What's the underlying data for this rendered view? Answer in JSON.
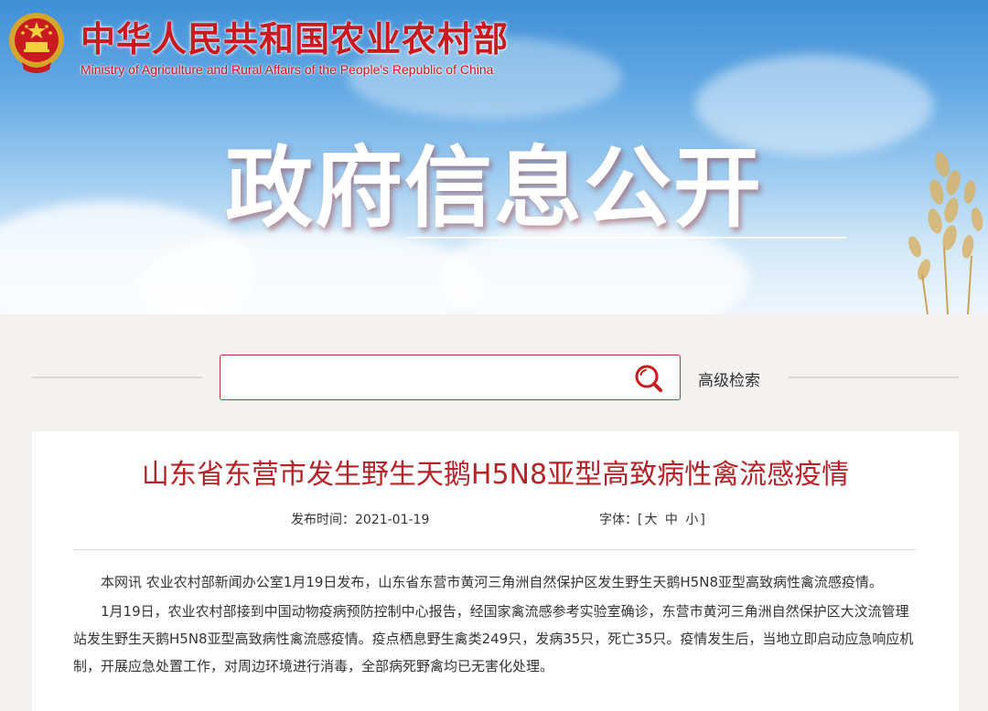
{
  "header": {
    "ministry_cn": "中华人民共和国农业农村部",
    "ministry_en": "Ministry of Agriculture and Rural Affairs of the People's Republic of China",
    "banner_title": "政府信息公开",
    "emblem_icon": "national-emblem-icon"
  },
  "search": {
    "placeholder": "",
    "value": "",
    "button_icon": "search-icon",
    "advanced_label": "高级检索"
  },
  "article": {
    "title": "山东省东营市发生野生天鹅H5N8亚型高致病性禽流感疫情",
    "date_label": "发布时间：",
    "date": "2021-01-19",
    "font_label": "字体：",
    "font_open": "[",
    "font_large": "大",
    "font_medium": "中",
    "font_small": "小",
    "font_close": "]",
    "paragraphs": [
      "本网讯  农业农村部新闻办公室1月19日发布，山东省东营市黄河三角洲自然保护区发生野生天鹅H5N8亚型高致病性禽流感疫情。",
      "1月19日，农业农村部接到中国动物疫病预防控制中心报告，经国家禽流感参考实验室确诊，东营市黄河三角洲自然保护区大汶流管理站发生野生天鹅H5N8亚型高致病性禽流感疫情。疫点栖息野生禽类249只，发病35只，死亡35只。疫情发生后，当地立即启动应急响应机制，开展应急处置工作，对周边环境进行消毒，全部病死野禽均已无害化处理。"
    ]
  },
  "colors": {
    "brand_red": "#c81a1f",
    "title_red": "#b32328",
    "page_bg": "#f4f2f1"
  }
}
